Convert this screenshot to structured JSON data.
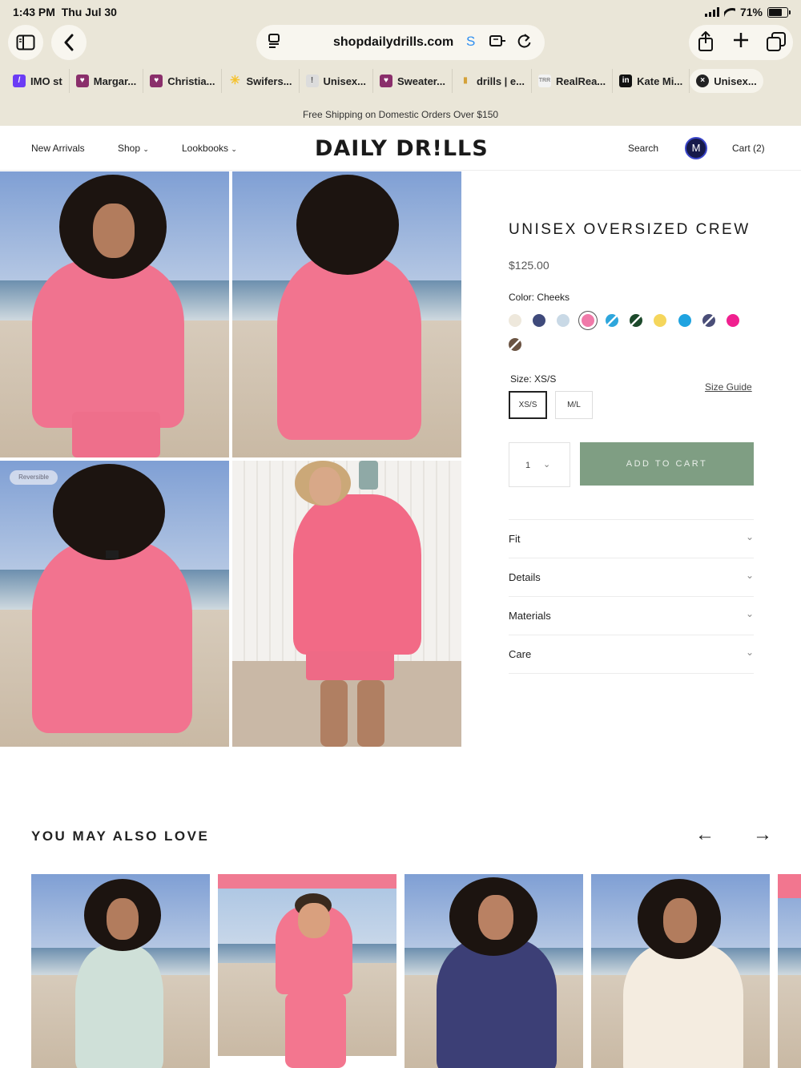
{
  "status_bar": {
    "time": "1:43 PM",
    "date": "Thu Jul 30",
    "battery": "71%"
  },
  "browser": {
    "url": "shopdailydrills.com",
    "tabs": [
      {
        "label": "IMO st",
        "icon": "purple-square-icon",
        "color": "#6b3cf5"
      },
      {
        "label": "Margar...",
        "icon": "shopify-icon",
        "color": "#8a2f6b"
      },
      {
        "label": "Christia...",
        "icon": "shopify-icon",
        "color": "#8a2f6b"
      },
      {
        "label": "Swifers...",
        "icon": "walmart-spark-icon",
        "color": "#f5c12b"
      },
      {
        "label": "Unisex...",
        "icon": "exclamation-icon",
        "color": "#bbbbbb"
      },
      {
        "label": "Sweater...",
        "icon": "shopify-icon",
        "color": "#8a2f6b"
      },
      {
        "label": "drills | e...",
        "icon": "bars-icon",
        "color": "#d4a23a"
      },
      {
        "label": "RealRea...",
        "icon": "realreal-icon",
        "color": "#dddddd"
      },
      {
        "label": "Kate Mi...",
        "icon": "linkedin-icon",
        "color": "#111111"
      },
      {
        "label": "Unisex...",
        "icon": "close-circle-icon",
        "color": "#222222"
      }
    ]
  },
  "announcement": "Free Shipping on Domestic Orders Over $150",
  "header": {
    "nav": [
      "New Arrivals",
      "Shop",
      "Lookbooks"
    ],
    "logo": "DAILY DR!LLS",
    "search": "Search",
    "avatar_initial": "M",
    "cart": "Cart (2)"
  },
  "gallery": {
    "badge": "Reversible"
  },
  "product": {
    "title": "UNISEX OVERSIZED CREW",
    "price": "$125.00",
    "color_label": "Color: Cheeks",
    "swatches": [
      {
        "color": "#eee8dc",
        "striped": false
      },
      {
        "color": "#3f4a7b",
        "striped": false
      },
      {
        "color": "#c9d9e6",
        "striped": false
      },
      {
        "color": "#f07aa9",
        "striped": false,
        "selected": true
      },
      {
        "color": "#2ea6dc",
        "striped": true
      },
      {
        "color": "#1d4a2c",
        "striped": true
      },
      {
        "color": "#f5d65c",
        "striped": false
      },
      {
        "color": "#1fa3e0",
        "striped": false
      },
      {
        "color": "#4a4e78",
        "striped": true
      },
      {
        "color": "#f0208f",
        "striped": false
      },
      {
        "color": "#6b5443",
        "striped": true
      }
    ],
    "size_label": "Size: XS/S",
    "size_guide": "Size Guide",
    "sizes": [
      "XS/S",
      "M/L"
    ],
    "quantity": "1",
    "add_to_cart": "ADD TO CART",
    "accordions": [
      "Fit",
      "Details",
      "Materials",
      "Care"
    ]
  },
  "recommendations": {
    "title": "YOU MAY ALSO LOVE"
  }
}
